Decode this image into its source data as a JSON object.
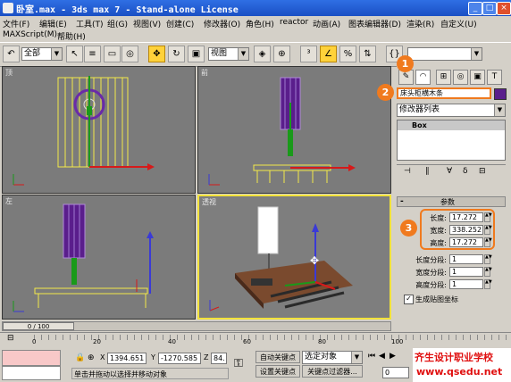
{
  "window": {
    "title": "卧室.max - 3ds max 7 - Stand-alone License",
    "buttons": [
      "_",
      "□",
      "×"
    ]
  },
  "menu": {
    "items": [
      "文件(F)",
      "编辑(E)",
      "工具(T)",
      "组(G)",
      "视图(V)",
      "创建(C)",
      "修改器(O)",
      "角色(H)",
      "reactor",
      "动画(A)",
      "图表编辑器(D)",
      "渲染(R)",
      "自定义(U)"
    ],
    "items2": [
      "MAXScript(M)",
      "帮助(H)"
    ]
  },
  "toolbar": {
    "selection_filter": "全部",
    "coord_system": "视图",
    "named_selection": ""
  },
  "viewports": {
    "top": "顶",
    "front": "前",
    "left": "左",
    "perspective": "透视"
  },
  "command_panel": {
    "callouts": [
      "1",
      "2",
      "3"
    ],
    "object_name": "床头柜横木条",
    "object_color": "#5a1e8c",
    "modifier_list": "修改器列表",
    "stack_item": "Box",
    "rollout_minus": "-",
    "rollout_title": "参数",
    "params": [
      {
        "label": "长度:",
        "value": "17.272"
      },
      {
        "label": "宽度:",
        "value": "338.252"
      },
      {
        "label": "高度:",
        "value": "17.272"
      },
      {
        "label": "长度分段:",
        "value": "1"
      },
      {
        "label": "宽度分段:",
        "value": "1"
      },
      {
        "label": "高度分段:",
        "value": "1"
      }
    ],
    "gen_uv": "生成贴图坐标"
  },
  "timeline": {
    "frame_display": "0 / 100",
    "ticks": [
      "0",
      "20",
      "40",
      "60",
      "80",
      "100"
    ]
  },
  "status": {
    "x_label": "X",
    "x_value": "1394.651",
    "y_label": "Y",
    "y_value": "-1270.585",
    "z_label": "Z",
    "z_value": "84.",
    "prompt": "单击并拖动以选择并移动对象",
    "auto_key": "自动关键点",
    "set_key": "设置关键点",
    "selected_object": "选定对象",
    "key_filters": "关键点过滤器...",
    "frame_field": "0"
  },
  "watermark": {
    "line1": "齐生设计职业学校",
    "line2": "www.qsedu.net"
  },
  "colors": {
    "accent": "#f07a1e",
    "viewport_bg": "#7b7b7b",
    "active_border": "#f2e23a",
    "watermark_red": "#e01010"
  }
}
